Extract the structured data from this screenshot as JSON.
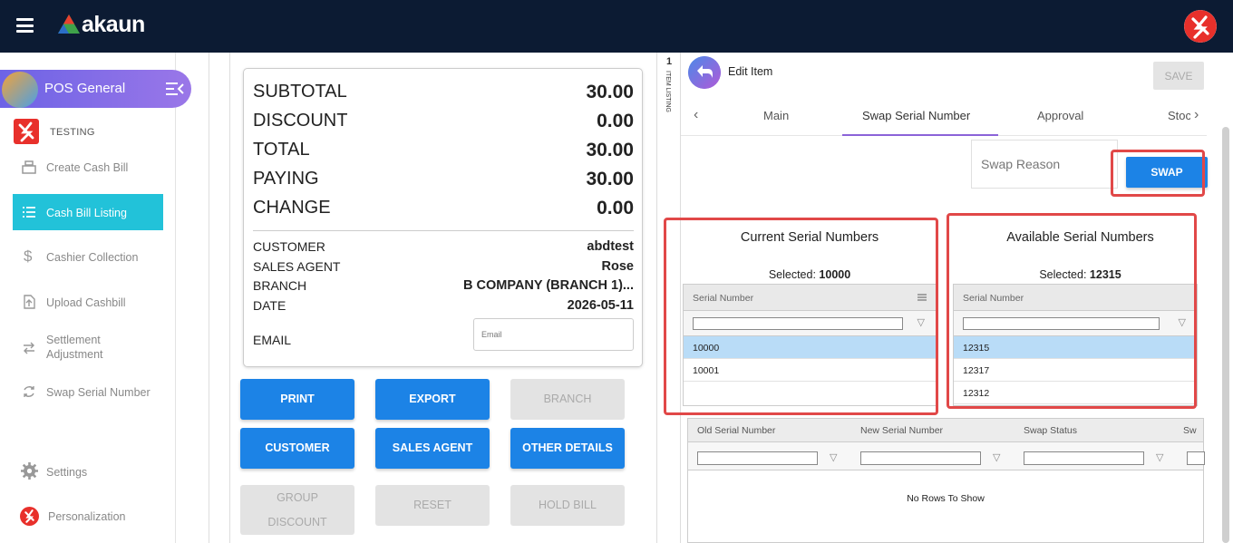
{
  "brand": {
    "name": "akaun"
  },
  "sidebar": {
    "app_title": "POS General",
    "group_label": "TESTING",
    "items": [
      {
        "label": "Create Cash Bill",
        "icon": "cash-register-icon"
      },
      {
        "label": "Cash Bill Listing",
        "icon": "list-icon",
        "active": true
      },
      {
        "label": "Cashier Collection",
        "icon": "dollar-icon"
      },
      {
        "label": "Upload Cashbill",
        "icon": "upload-icon"
      },
      {
        "label": "Settlement Adjustment",
        "icon": "arrows-icon"
      },
      {
        "label": "Swap Serial Number",
        "icon": "swap-icon"
      }
    ],
    "settings_label": "Settings",
    "personalization_label": "Personalization"
  },
  "summary": {
    "subtotal_label": "SUBTOTAL",
    "subtotal": "30.00",
    "discount_label": "DISCOUNT",
    "discount": "0.00",
    "total_label": "TOTAL",
    "total": "30.00",
    "paying_label": "PAYING",
    "paying": "30.00",
    "change_label": "CHANGE",
    "change": "0.00",
    "customer_label": "CUSTOMER",
    "customer": "abdtest",
    "agent_label": "SALES AGENT",
    "agent": "Rose",
    "branch_label": "BRANCH",
    "branch": "B COMPANY (BRANCH 1)...",
    "date_label": "DATE",
    "date": "2026-05-11",
    "email_label": "EMAIL",
    "email_placeholder": "Email"
  },
  "buttons": {
    "print": "PRINT",
    "export": "EXPORT",
    "branch": "BRANCH",
    "customer": "CUSTOMER",
    "sales_agent": "SALES AGENT",
    "other_details": "OTHER DETAILS",
    "group_discount": "GROUP DISCOUNT",
    "reset": "RESET",
    "hold_bill": "HOLD BILL"
  },
  "strip": {
    "number": "1",
    "label": "ITEM LISTING"
  },
  "panel": {
    "title": "Edit Item",
    "save": "SAVE",
    "tabs": [
      "Main",
      "Swap Serial Number",
      "Approval",
      "Stoc"
    ],
    "swap_reason_placeholder": "Swap Reason",
    "swap": "SWAP",
    "current": {
      "title": "Current Serial Numbers",
      "selected_label": "Selected:",
      "selected_value": "10000",
      "column": "Serial Number",
      "rows": [
        "10000",
        "10001"
      ]
    },
    "available": {
      "title": "Available Serial Numbers",
      "selected_label": "Selected:",
      "selected_value": "12315",
      "column": "Serial Number",
      "rows": [
        "12315",
        "12317",
        "12312"
      ]
    },
    "history": {
      "columns": [
        "Old Serial Number",
        "New Serial Number",
        "Swap Status",
        "Sw"
      ],
      "empty": "No Rows To Show"
    }
  },
  "colors": {
    "primary": "#1c83e6",
    "active_nav": "#22c2d9",
    "highlight": "#e14848",
    "topbar": "#0c1b33"
  }
}
